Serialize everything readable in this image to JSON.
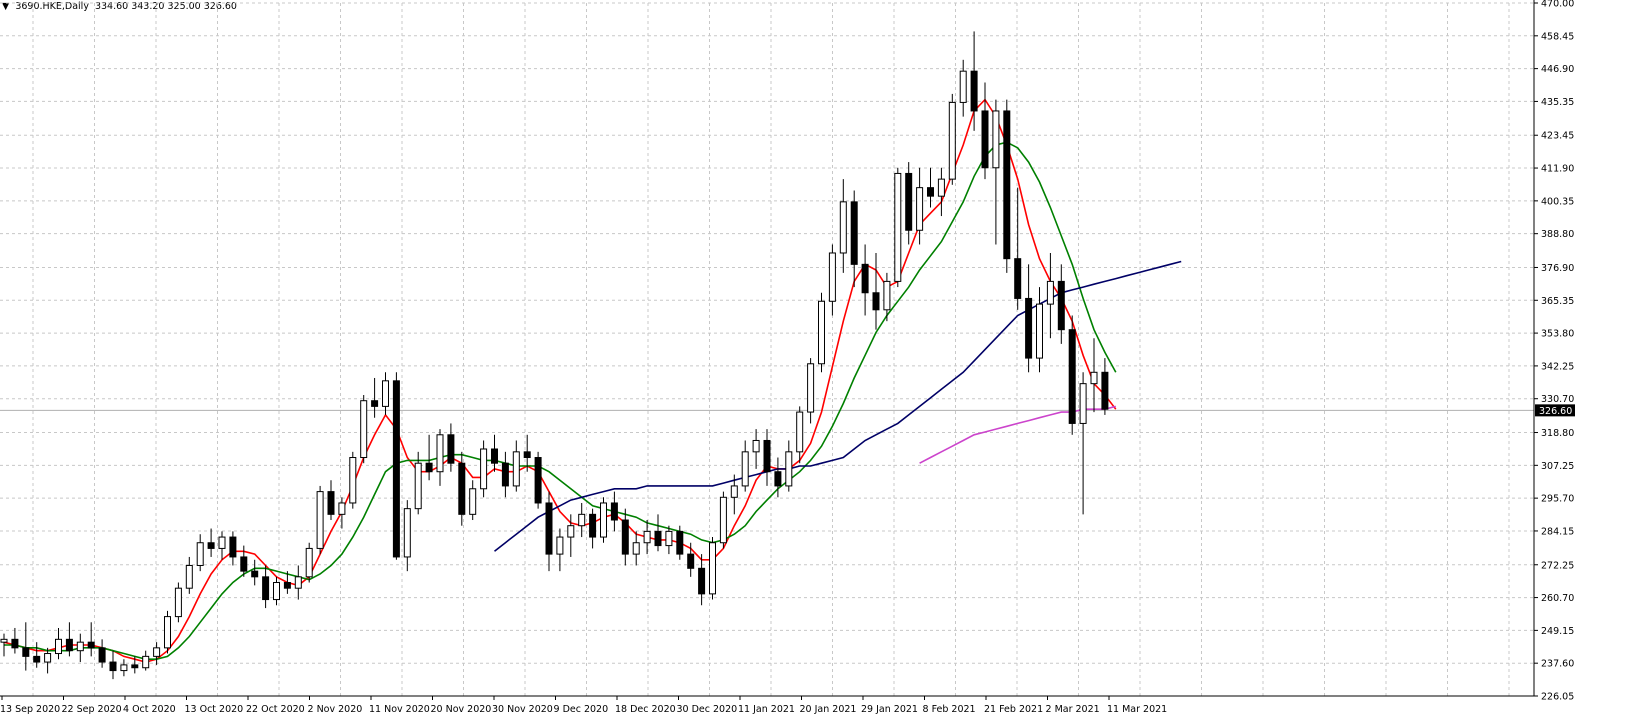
{
  "header": {
    "dropdown_icon": "triangle-down-icon",
    "symbol": "3690.HKE,Daily",
    "ohlc": "334.60 343.20 325.00 326.60"
  },
  "colors": {
    "background": "#ffffff",
    "grid": "#c8c8c8",
    "candle_body_bull": "#ffffff",
    "candle_body_bear": "#000000",
    "ma_fast": "#ff0000",
    "ma_mid": "#008000",
    "ma_slow": "#000066",
    "ma_long": "#cc44cc",
    "price_line": "#b0b0b0"
  },
  "chart_data": {
    "type": "candlestick",
    "grid": true,
    "ylim": [
      226.05,
      470.0
    ],
    "y_ticks": [
      "470.00",
      "458.45",
      "446.90",
      "435.35",
      "423.45",
      "411.90",
      "400.35",
      "388.80",
      "376.90",
      "365.35",
      "353.80",
      "342.25",
      "330.70",
      "318.80",
      "307.25",
      "295.70",
      "284.15",
      "272.25",
      "260.70",
      "249.15",
      "237.60",
      "226.05"
    ],
    "x_ticks": [
      "13 Sep 2020",
      "22 Sep 2020",
      "4 Oct 2020",
      "13 Oct 2020",
      "22 Oct 2020",
      "2 Nov 2020",
      "11 Nov 2020",
      "20 Nov 2020",
      "30 Nov 2020",
      "9 Dec 2020",
      "18 Dec 2020",
      "30 Dec 2020",
      "11 Jan 2021",
      "20 Jan 2021",
      "29 Jan 2021",
      "8 Feb 2021",
      "21 Feb 2021",
      "2 Mar 2021",
      "11 Mar 2021"
    ],
    "current_price": "326.60",
    "candles": [
      [
        245,
        248,
        240,
        246
      ],
      [
        246,
        250,
        241,
        243
      ],
      [
        243,
        252,
        235,
        240
      ],
      [
        240,
        245,
        236,
        238
      ],
      [
        238,
        243,
        234,
        241
      ],
      [
        241,
        250,
        239,
        246
      ],
      [
        246,
        252,
        240,
        242
      ],
      [
        242,
        248,
        238,
        245
      ],
      [
        245,
        252,
        240,
        243
      ],
      [
        243,
        246,
        236,
        238
      ],
      [
        238,
        242,
        232,
        235
      ],
      [
        235,
        239,
        233,
        237
      ],
      [
        237,
        240,
        234,
        236
      ],
      [
        236,
        242,
        235,
        240
      ],
      [
        240,
        245,
        237,
        243
      ],
      [
        243,
        256,
        241,
        254
      ],
      [
        254,
        266,
        252,
        264
      ],
      [
        264,
        275,
        262,
        272
      ],
      [
        272,
        283,
        270,
        280
      ],
      [
        280,
        285,
        275,
        278
      ],
      [
        278,
        284,
        274,
        282
      ],
      [
        282,
        284,
        272,
        275
      ],
      [
        275,
        279,
        268,
        270
      ],
      [
        270,
        274,
        265,
        268
      ],
      [
        268,
        272,
        257,
        260
      ],
      [
        260,
        268,
        258,
        266
      ],
      [
        266,
        270,
        262,
        264
      ],
      [
        264,
        272,
        260,
        268
      ],
      [
        268,
        280,
        266,
        278
      ],
      [
        278,
        300,
        276,
        298
      ],
      [
        298,
        302,
        288,
        290
      ],
      [
        290,
        296,
        285,
        294
      ],
      [
        294,
        312,
        292,
        310
      ],
      [
        310,
        332,
        308,
        330
      ],
      [
        330,
        338,
        324,
        328
      ],
      [
        328,
        340,
        325,
        337
      ],
      [
        337,
        340,
        274,
        275
      ],
      [
        275,
        295,
        270,
        292
      ],
      [
        292,
        312,
        290,
        308
      ],
      [
        308,
        318,
        302,
        305
      ],
      [
        305,
        320,
        300,
        318
      ],
      [
        318,
        322,
        305,
        308
      ],
      [
        308,
        312,
        286,
        290
      ],
      [
        290,
        302,
        288,
        299
      ],
      [
        299,
        316,
        296,
        313
      ],
      [
        313,
        318,
        305,
        308
      ],
      [
        308,
        312,
        296,
        300
      ],
      [
        300,
        316,
        298,
        312
      ],
      [
        312,
        318,
        305,
        310
      ],
      [
        310,
        312,
        292,
        294
      ],
      [
        294,
        298,
        270,
        276
      ],
      [
        276,
        285,
        270,
        282
      ],
      [
        282,
        290,
        275,
        286
      ],
      [
        286,
        294,
        282,
        290
      ],
      [
        290,
        292,
        278,
        282
      ],
      [
        282,
        296,
        280,
        294
      ],
      [
        294,
        298,
        284,
        288
      ],
      [
        288,
        292,
        272,
        276
      ],
      [
        276,
        284,
        272,
        280
      ],
      [
        280,
        288,
        276,
        284
      ],
      [
        284,
        290,
        277,
        279
      ],
      [
        279,
        286,
        276,
        284
      ],
      [
        284,
        286,
        274,
        276
      ],
      [
        276,
        280,
        268,
        271
      ],
      [
        271,
        276,
        258,
        262
      ],
      [
        262,
        282,
        260,
        280
      ],
      [
        280,
        298,
        278,
        296
      ],
      [
        296,
        304,
        290,
        300
      ],
      [
        300,
        316,
        298,
        312
      ],
      [
        312,
        320,
        306,
        316
      ],
      [
        316,
        320,
        300,
        305
      ],
      [
        305,
        310,
        296,
        300
      ],
      [
        300,
        316,
        298,
        312
      ],
      [
        312,
        328,
        308,
        326
      ],
      [
        326,
        345,
        322,
        343
      ],
      [
        343,
        368,
        340,
        365
      ],
      [
        365,
        385,
        360,
        382
      ],
      [
        382,
        408,
        375,
        400
      ],
      [
        400,
        404,
        370,
        378
      ],
      [
        378,
        385,
        360,
        368
      ],
      [
        368,
        382,
        355,
        362
      ],
      [
        362,
        375,
        358,
        372
      ],
      [
        372,
        412,
        370,
        410
      ],
      [
        410,
        414,
        385,
        390
      ],
      [
        390,
        412,
        385,
        405
      ],
      [
        405,
        412,
        398,
        402
      ],
      [
        402,
        412,
        395,
        408
      ],
      [
        408,
        438,
        406,
        435
      ],
      [
        435,
        450,
        430,
        446
      ],
      [
        446,
        460,
        425,
        432
      ],
      [
        432,
        442,
        408,
        412
      ],
      [
        412,
        436,
        385,
        432
      ],
      [
        432,
        436,
        375,
        380
      ],
      [
        380,
        405,
        362,
        366
      ],
      [
        366,
        378,
        340,
        345
      ],
      [
        345,
        370,
        340,
        364
      ],
      [
        364,
        382,
        352,
        372
      ],
      [
        372,
        378,
        350,
        355
      ],
      [
        355,
        360,
        318,
        322
      ],
      [
        322,
        340,
        290,
        336
      ],
      [
        336,
        352,
        326,
        340
      ],
      [
        340,
        345,
        325,
        327
      ]
    ],
    "series": [
      {
        "type": "line",
        "values": [
          245,
          244,
          243,
          242,
          242,
          243,
          244,
          244,
          244,
          243,
          242,
          240,
          239,
          238,
          239,
          242,
          247,
          254,
          262,
          269,
          274,
          277,
          277,
          276,
          272,
          268,
          266,
          265,
          268,
          276,
          284,
          291,
          300,
          310,
          318,
          325,
          320,
          310,
          305,
          305,
          307,
          310,
          308,
          303,
          303,
          306,
          305,
          305,
          307,
          305,
          298,
          291,
          287,
          286,
          287,
          289,
          290,
          287,
          283,
          282,
          281,
          281,
          280,
          278,
          274,
          274,
          278,
          286,
          293,
          302,
          307,
          306,
          306,
          309,
          315,
          326,
          342,
          358,
          372,
          378,
          376,
          370,
          372,
          382,
          392,
          396,
          400,
          410,
          420,
          432,
          436,
          430,
          420,
          408,
          392,
          380,
          372,
          366,
          358,
          346,
          336,
          332,
          327
        ],
        "color": "#ff0000"
      },
      {
        "type": "line",
        "values": [
          244,
          244,
          243,
          243,
          242,
          242,
          242,
          243,
          243,
          243,
          242,
          241,
          240,
          239,
          239,
          240,
          243,
          247,
          252,
          257,
          262,
          266,
          269,
          271,
          271,
          270,
          269,
          268,
          267,
          269,
          272,
          276,
          282,
          289,
          297,
          305,
          308,
          309,
          309,
          309,
          310,
          311,
          311,
          310,
          309,
          309,
          308,
          307,
          307,
          307,
          305,
          302,
          299,
          296,
          293,
          292,
          291,
          290,
          289,
          287,
          286,
          285,
          284,
          283,
          281,
          280,
          281,
          283,
          286,
          291,
          295,
          299,
          302,
          305,
          309,
          314,
          321,
          329,
          338,
          346,
          354,
          360,
          365,
          370,
          376,
          381,
          386,
          393,
          400,
          409,
          416,
          420,
          421,
          419,
          414,
          407,
          398,
          388,
          378,
          366,
          355,
          347,
          340
        ],
        "color": "#008000"
      },
      {
        "type": "line",
        "start_index": 45,
        "values": [
          277,
          280,
          283,
          286,
          289,
          291,
          293,
          295,
          296,
          297,
          298,
          299,
          299,
          299,
          300,
          300,
          300,
          300,
          300,
          300,
          300,
          301,
          302,
          303,
          304,
          305,
          306,
          306,
          307,
          307,
          308,
          309,
          310,
          313,
          316,
          318,
          320,
          322,
          325,
          328,
          331,
          334,
          337,
          340,
          344,
          348,
          352,
          356,
          360,
          362,
          364,
          366,
          368,
          369,
          370,
          371,
          372,
          373,
          374,
          375,
          376,
          377,
          378,
          379
        ],
        "color": "#000066"
      },
      {
        "type": "line",
        "start_index": 84,
        "values": [
          308,
          310,
          312,
          314,
          316,
          318,
          319,
          320,
          321,
          322,
          323,
          324,
          325,
          326,
          326,
          327,
          327,
          327,
          328
        ],
        "color": "#cc44cc"
      }
    ]
  }
}
